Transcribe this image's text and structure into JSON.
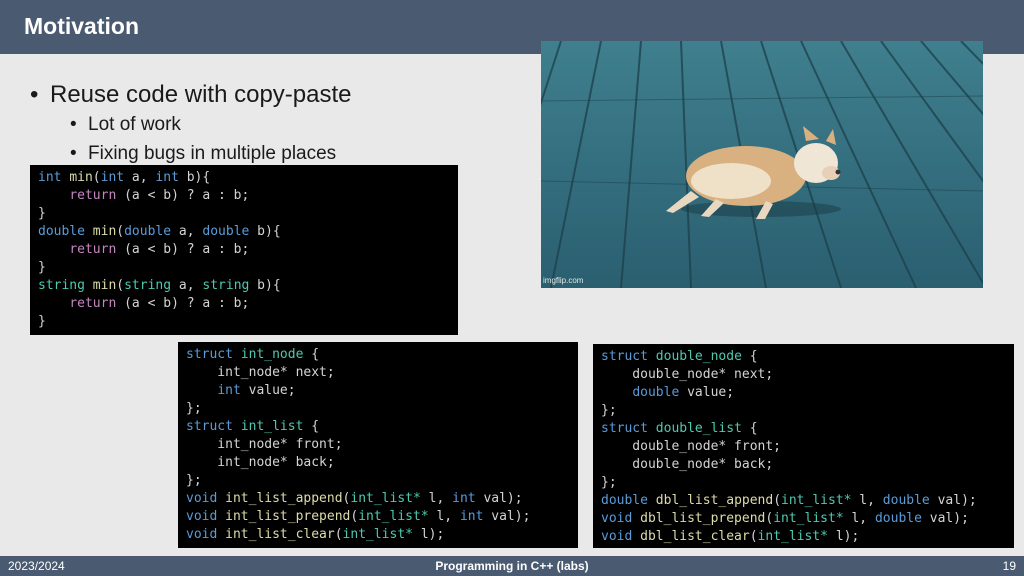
{
  "slide": {
    "title": "Motivation",
    "bullets": {
      "main": "Reuse code with copy-paste",
      "sub": [
        "Lot of work",
        "Fixing bugs in multiple places"
      ]
    },
    "image": {
      "watermark": "imgflip.com",
      "description_icon": "tired-dog-photo"
    }
  },
  "code_min": {
    "lines": [
      [
        [
          "int",
          "kw"
        ],
        [
          " ",
          ""
        ],
        [
          "min",
          "fn"
        ],
        [
          "(",
          ""
        ],
        [
          "int",
          "kw"
        ],
        [
          " a, ",
          ""
        ],
        [
          "int",
          "kw"
        ],
        [
          " b){",
          ""
        ]
      ],
      [
        [
          "    ",
          ""
        ],
        [
          "return",
          "kwp"
        ],
        [
          " (a < b) ? a : b;",
          ""
        ]
      ],
      [
        [
          "}",
          ""
        ]
      ],
      [
        [
          "double",
          "kw"
        ],
        [
          " ",
          ""
        ],
        [
          "min",
          "fn"
        ],
        [
          "(",
          ""
        ],
        [
          "double",
          "kw"
        ],
        [
          " a, ",
          ""
        ],
        [
          "double",
          "kw"
        ],
        [
          " b){",
          ""
        ]
      ],
      [
        [
          "    ",
          ""
        ],
        [
          "return",
          "kwp"
        ],
        [
          " (a < b) ? a : b;",
          ""
        ]
      ],
      [
        [
          "}",
          ""
        ]
      ],
      [
        [
          "string",
          "ty"
        ],
        [
          " ",
          ""
        ],
        [
          "min",
          "fn"
        ],
        [
          "(",
          ""
        ],
        [
          "string",
          "ty"
        ],
        [
          " a, ",
          ""
        ],
        [
          "string",
          "ty"
        ],
        [
          " b){",
          ""
        ]
      ],
      [
        [
          "    ",
          ""
        ],
        [
          "return",
          "kwp"
        ],
        [
          " (a < b) ? a : b;",
          ""
        ]
      ],
      [
        [
          "}",
          ""
        ]
      ]
    ]
  },
  "code_int": {
    "lines": [
      [
        [
          "struct",
          "kw"
        ],
        [
          " ",
          ""
        ],
        [
          "int_node",
          "ty"
        ],
        [
          " {",
          ""
        ]
      ],
      [
        [
          "    int_node* next;",
          ""
        ]
      ],
      [
        [
          "    ",
          ""
        ],
        [
          "int",
          "kw"
        ],
        [
          " value;",
          ""
        ]
      ],
      [
        [
          "};",
          ""
        ]
      ],
      [
        [
          "struct",
          "kw"
        ],
        [
          " ",
          ""
        ],
        [
          "int_list",
          "ty"
        ],
        [
          " {",
          ""
        ]
      ],
      [
        [
          "    int_node* front;",
          ""
        ]
      ],
      [
        [
          "    int_node* back;",
          ""
        ]
      ],
      [
        [
          "};",
          ""
        ]
      ],
      [
        [
          "void",
          "kw"
        ],
        [
          " ",
          ""
        ],
        [
          "int_list_append",
          "fn"
        ],
        [
          "(",
          ""
        ],
        [
          "int_list*",
          "ty"
        ],
        [
          " l, ",
          ""
        ],
        [
          "int",
          "kw"
        ],
        [
          " val);",
          ""
        ]
      ],
      [
        [
          "void",
          "kw"
        ],
        [
          " ",
          ""
        ],
        [
          "int_list_prepend",
          "fn"
        ],
        [
          "(",
          ""
        ],
        [
          "int_list*",
          "ty"
        ],
        [
          " l, ",
          ""
        ],
        [
          "int",
          "kw"
        ],
        [
          " val);",
          ""
        ]
      ],
      [
        [
          "void",
          "kw"
        ],
        [
          " ",
          ""
        ],
        [
          "int_list_clear",
          "fn"
        ],
        [
          "(",
          ""
        ],
        [
          "int_list*",
          "ty"
        ],
        [
          " l);",
          ""
        ]
      ]
    ]
  },
  "code_dbl": {
    "lines": [
      [
        [
          "struct",
          "kw"
        ],
        [
          " ",
          ""
        ],
        [
          "double_node",
          "ty"
        ],
        [
          " {",
          ""
        ]
      ],
      [
        [
          "    double_node* next;",
          ""
        ]
      ],
      [
        [
          "    ",
          ""
        ],
        [
          "double",
          "kw"
        ],
        [
          " value;",
          ""
        ]
      ],
      [
        [
          "};",
          ""
        ]
      ],
      [
        [
          "struct",
          "kw"
        ],
        [
          " ",
          ""
        ],
        [
          "double_list",
          "ty"
        ],
        [
          " {",
          ""
        ]
      ],
      [
        [
          "    double_node* front;",
          ""
        ]
      ],
      [
        [
          "    double_node* back;",
          ""
        ]
      ],
      [
        [
          "};",
          ""
        ]
      ],
      [
        [
          "double",
          "kw"
        ],
        [
          " ",
          ""
        ],
        [
          "dbl_list_append",
          "fn"
        ],
        [
          "(",
          ""
        ],
        [
          "int_list*",
          "ty"
        ],
        [
          " l, ",
          ""
        ],
        [
          "double",
          "kw"
        ],
        [
          " val);",
          ""
        ]
      ],
      [
        [
          "void",
          "kw"
        ],
        [
          " ",
          ""
        ],
        [
          "dbl_list_prepend",
          "fn"
        ],
        [
          "(",
          ""
        ],
        [
          "int_list*",
          "ty"
        ],
        [
          " l, ",
          ""
        ],
        [
          "double",
          "kw"
        ],
        [
          " val);",
          ""
        ]
      ],
      [
        [
          "void",
          "kw"
        ],
        [
          " ",
          ""
        ],
        [
          "dbl_list_clear",
          "fn"
        ],
        [
          "(",
          ""
        ],
        [
          "int_list*",
          "ty"
        ],
        [
          " l);",
          ""
        ]
      ]
    ]
  },
  "footer": {
    "date": "2023/2024",
    "course": "Programming in C++ (labs)",
    "page": "19"
  },
  "colors": {
    "title_bar": "#4a5a70",
    "background": "#e9e9e9",
    "code_bg": "#000000",
    "keyword": "#5a9bd8",
    "type": "#4ec9b0",
    "function": "#dcdcaa"
  }
}
